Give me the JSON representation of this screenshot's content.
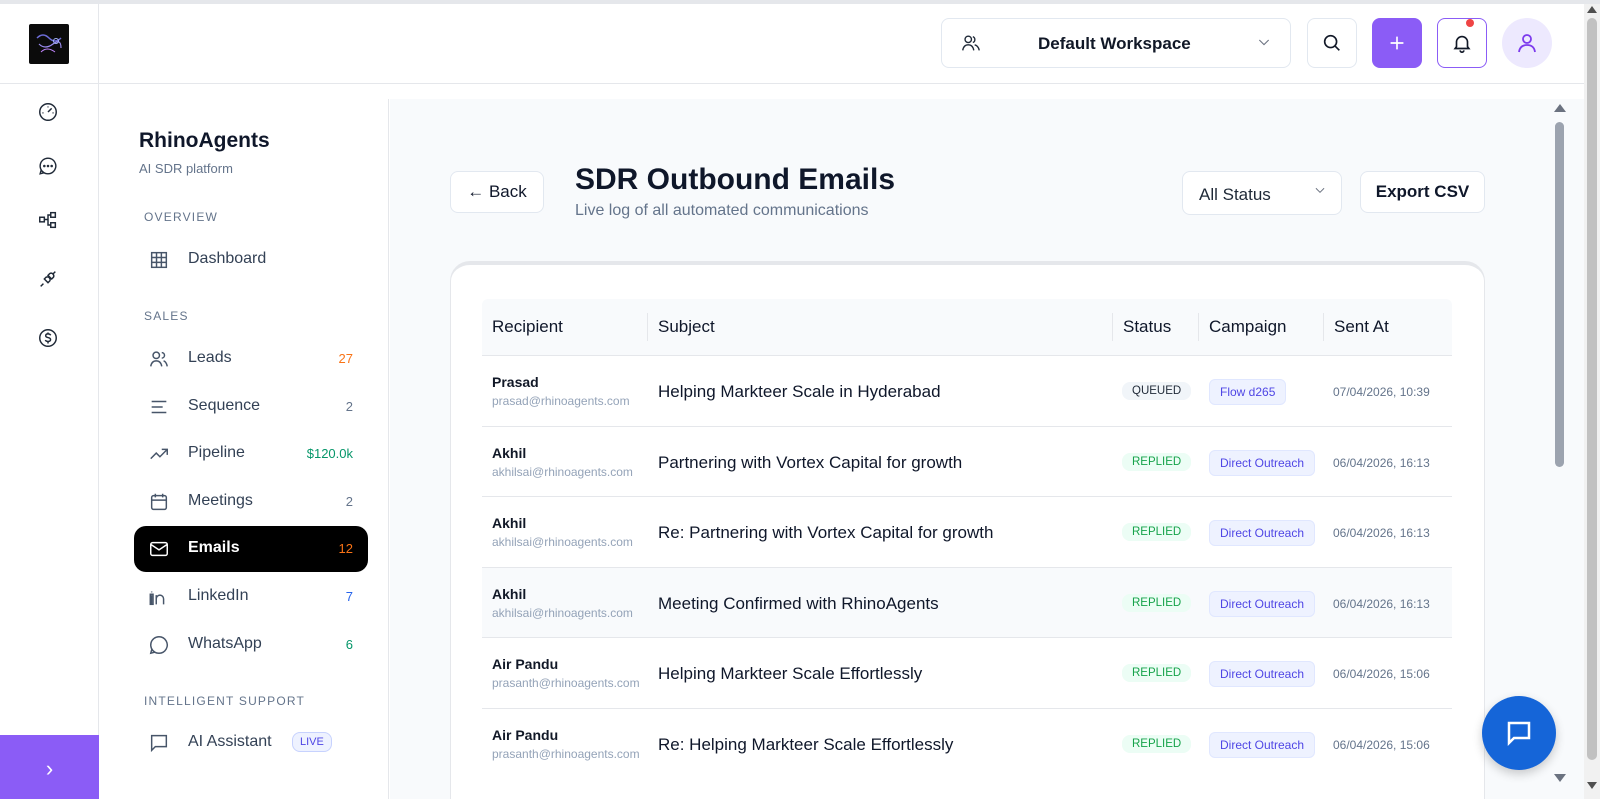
{
  "header": {
    "workspace_label": "Default Workspace"
  },
  "sidebar": {
    "brand": "RhinoAgents",
    "brand_sub": "AI SDR platform",
    "sections": {
      "overview": "OVERVIEW",
      "sales": "SALES",
      "support": "INTELLIGENT SUPPORT"
    },
    "items": [
      {
        "label": "Dashboard",
        "count": ""
      },
      {
        "label": "Leads",
        "count": "27",
        "count_color": "#f97316"
      },
      {
        "label": "Sequence",
        "count": "2",
        "count_color": "#64748b"
      },
      {
        "label": "Pipeline",
        "count": "$120.0k",
        "count_color": "#059669"
      },
      {
        "label": "Meetings",
        "count": "2",
        "count_color": "#64748b"
      },
      {
        "label": "Emails",
        "count": "12",
        "count_color": "#f97316"
      },
      {
        "label": "LinkedIn",
        "count": "7",
        "count_color": "#2563eb"
      },
      {
        "label": "WhatsApp",
        "count": "6",
        "count_color": "#059669"
      },
      {
        "label": "AI Assistant",
        "badge": "LIVE"
      }
    ]
  },
  "page": {
    "back_label": "← Back",
    "title": "SDR Outbound Emails",
    "subtitle": "Live log of all automated communications",
    "status_filter": "All Status",
    "export_label": "Export CSV"
  },
  "table": {
    "columns": [
      "Recipient",
      "Subject",
      "Status",
      "Campaign",
      "Sent At"
    ],
    "rows": [
      {
        "name": "Prasad",
        "email": "prasad@rhinoagents.com",
        "subject": "Helping Markteer Scale in Hyderabad",
        "status": "QUEUED",
        "campaign": "Flow d265",
        "sent": "07/04/2026, 10:39"
      },
      {
        "name": "Akhil",
        "email": "akhilsai@rhinoagents.com",
        "subject": "Partnering with Vortex Capital for growth",
        "status": "REPLIED",
        "campaign": "Direct Outreach",
        "sent": "06/04/2026, 16:13"
      },
      {
        "name": "Akhil",
        "email": "akhilsai@rhinoagents.com",
        "subject": "Re: Partnering with Vortex Capital for growth",
        "status": "REPLIED",
        "campaign": "Direct Outreach",
        "sent": "06/04/2026, 16:13"
      },
      {
        "name": "Akhil",
        "email": "akhilsai@rhinoagents.com",
        "subject": "Meeting Confirmed with RhinoAgents",
        "status": "REPLIED",
        "campaign": "Direct Outreach",
        "sent": "06/04/2026, 16:13"
      },
      {
        "name": "Air Pandu",
        "email": "prasanth@rhinoagents.com",
        "subject": "Helping Markteer Scale Effortlessly",
        "status": "REPLIED",
        "campaign": "Direct Outreach",
        "sent": "06/04/2026, 15:06"
      },
      {
        "name": "Air Pandu",
        "email": "prasanth@rhinoagents.com",
        "subject": "Re: Helping Markteer Scale Effortlessly",
        "status": "REPLIED",
        "campaign": "Direct Outreach",
        "sent": "06/04/2026, 15:06"
      }
    ]
  },
  "colors": {
    "accent": "#8b5cf6",
    "active_nav": "#000000",
    "chat_fab": "#1565d8"
  }
}
